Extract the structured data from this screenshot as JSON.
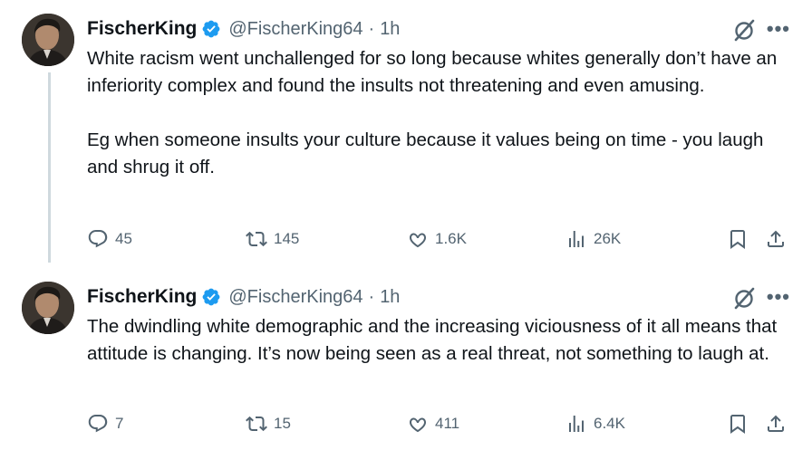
{
  "tweets": [
    {
      "author_name": "FischerKing",
      "handle": "@FischerKing64",
      "separator": "·",
      "time": "1h",
      "paragraphs": [
        "White racism went unchallenged for so long because whites generally don’t have an inferiority complex and found the insults not threatening and even amusing.",
        "Eg when someone insults your culture because it values being on time - you laugh and shrug it off."
      ],
      "replies": "45",
      "reposts": "145",
      "likes": "1.6K",
      "views": "26K"
    },
    {
      "author_name": "FischerKing",
      "handle": "@FischerKing64",
      "separator": "·",
      "time": "1h",
      "paragraphs": [
        "The dwindling white demographic and the increasing viciousness of it all means that attitude is changing. It’s now being seen as a real threat, not something to laugh at."
      ],
      "replies": "7",
      "reposts": "15",
      "likes": "411",
      "views": "6.4K"
    }
  ],
  "icons": {
    "verified": "verified-badge-icon",
    "grok": "grok-icon",
    "more": "more-icon",
    "reply": "reply-icon",
    "repost": "repost-icon",
    "like": "heart-icon",
    "views": "views-icon",
    "bookmark": "bookmark-icon",
    "share": "share-icon"
  },
  "colors": {
    "text": "#0f1419",
    "secondary": "#536471",
    "verified": "#1d9bf0",
    "thread_line": "#cfd9de"
  }
}
